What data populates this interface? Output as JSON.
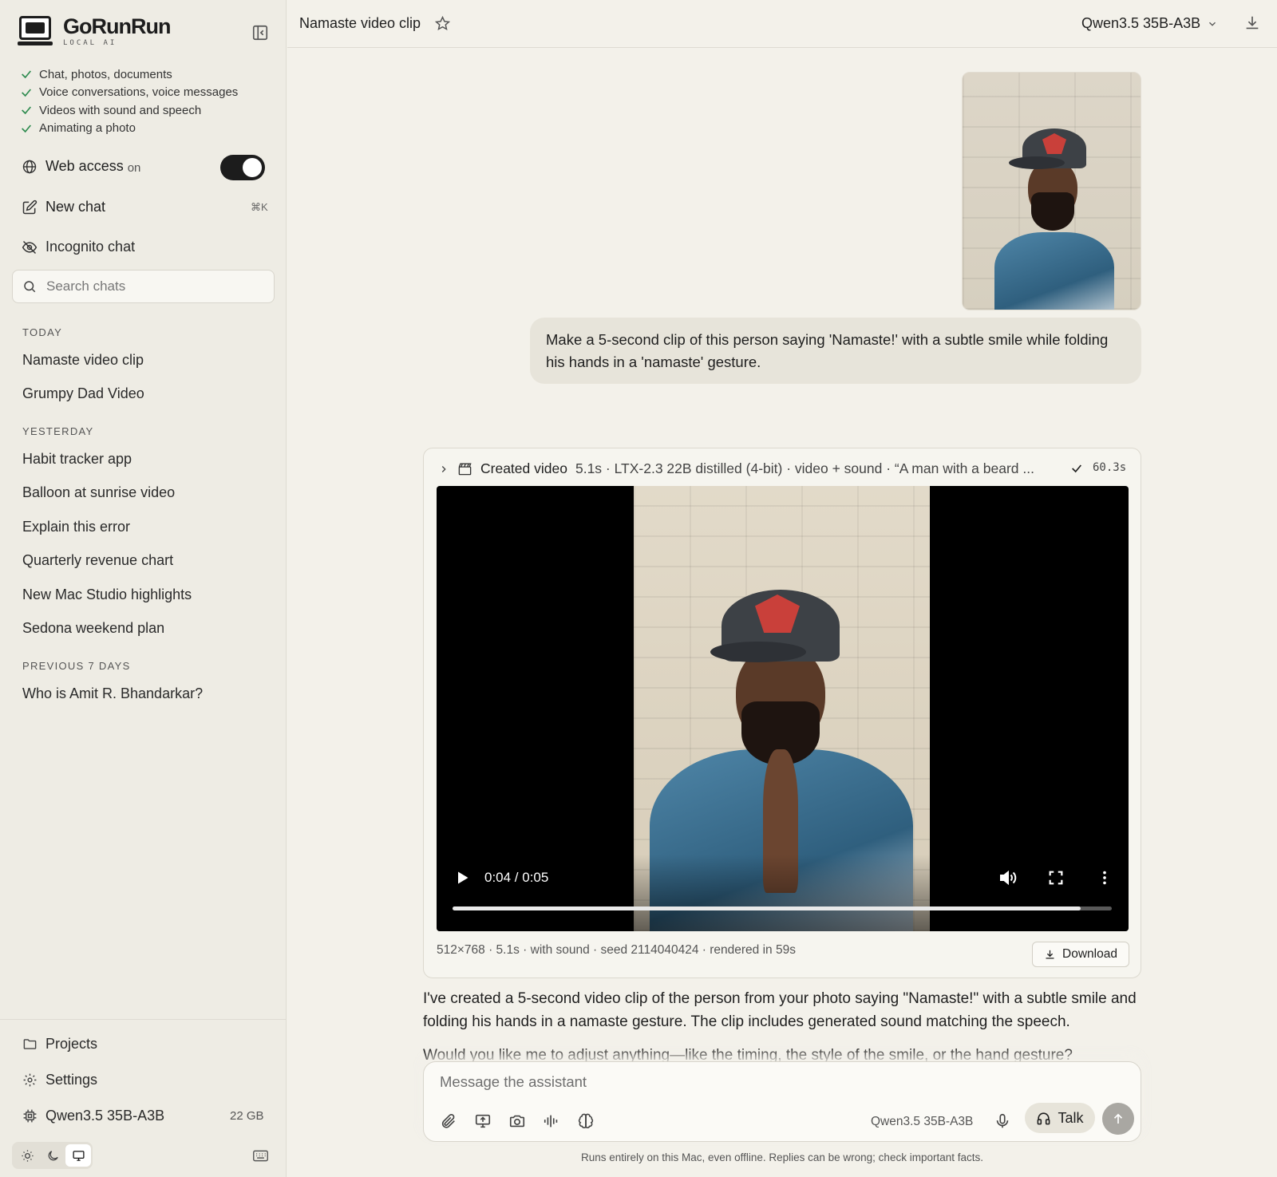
{
  "app": {
    "name": "GoRunRun",
    "tagline": "LOCAL AI"
  },
  "sidebar": {
    "features": [
      "Chat, photos, documents",
      "Voice conversations, voice messages",
      "Videos with sound and speech",
      "Animating a photo"
    ],
    "web_access": {
      "label": "Web access",
      "state": "on",
      "enabled": true
    },
    "new_chat": {
      "label": "New chat",
      "shortcut": "⌘K"
    },
    "incognito": {
      "label": "Incognito chat"
    },
    "search": {
      "placeholder": "Search chats"
    },
    "sections": [
      {
        "label": "TODAY",
        "items": [
          "Namaste video clip",
          "Grumpy Dad Video"
        ]
      },
      {
        "label": "YESTERDAY",
        "items": [
          "Habit tracker app",
          "Balloon at sunrise video",
          "Explain this error",
          "Quarterly revenue chart",
          "New Mac Studio highlights",
          "Sedona weekend plan"
        ]
      },
      {
        "label": "PREVIOUS 7 DAYS",
        "items": [
          "Who is Amit R. Bhandarkar?"
        ]
      }
    ],
    "bottom": {
      "projects": "Projects",
      "settings": "Settings",
      "model": "Qwen3.5 35B-A3B",
      "model_size": "22 GB",
      "theme_selected": "system"
    }
  },
  "header": {
    "title": "Namaste video clip",
    "model": "Qwen3.5 35B-A3B"
  },
  "conversation": {
    "user_message": "Make a 5-second clip of this person saying 'Namaste!' with a subtle smile while folding his hands in a 'namaste' gesture.",
    "video_card": {
      "label": "Created video",
      "meta": "5.1s · LTX-2.3 22B distilled (4-bit) · video + sound · “A man with a beard ...",
      "elapsed": "60.3s",
      "player": {
        "time": "0:04 / 0:05",
        "progress": 0.953
      },
      "footer": "512×768 · 5.1s · with sound · seed 2114040424 · rendered in 59s",
      "download_label": "Download"
    },
    "assistant_paragraphs": [
      "I've created a 5-second video clip of the person from your photo saying \"Namaste!\" with a subtle smile and folding his hands in a namaste gesture. The clip includes generated sound matching the speech.",
      "Would you like me to adjust anything—like the timing, the style of the smile, or the hand gesture?"
    ]
  },
  "composer": {
    "placeholder": "Message the assistant",
    "model": "Qwen3.5 35B-A3B",
    "talk_label": "Talk"
  },
  "footer": {
    "disclaimer": "Runs entirely on this Mac, even offline. Replies can be wrong; check important facts."
  }
}
